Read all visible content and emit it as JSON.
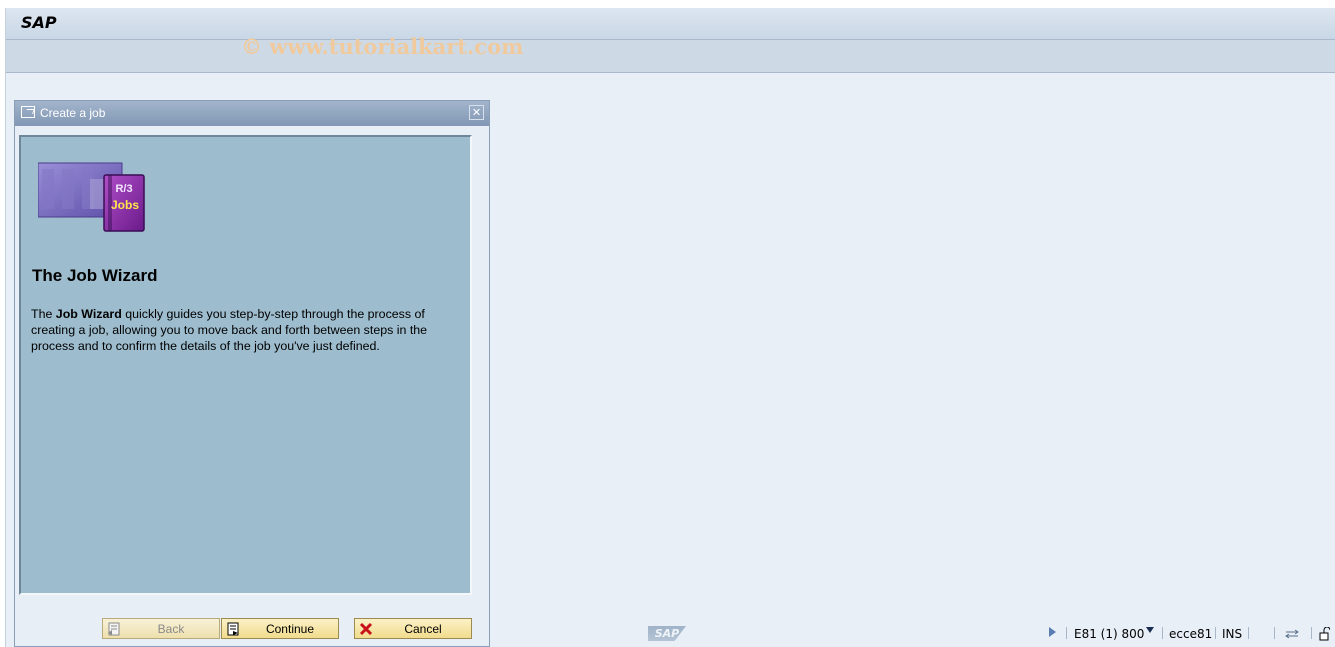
{
  "app": {
    "title": "SAP",
    "watermark": "© www.tutorialkart.com"
  },
  "dialog": {
    "title": "Create a job",
    "close_icon": "close-icon",
    "logo": {
      "line1": "R/3",
      "line2": "Jobs"
    },
    "heading": "The Job Wizard",
    "description": {
      "prefix": "The ",
      "bold": "Job Wizard",
      "suffix": " quickly guides you step-by-step through the process of creating a job, allowing you to move back and forth between steps in the process and to confirm the details of the job you've just defined."
    },
    "buttons": {
      "back": "Back",
      "continue": "Continue",
      "cancel": "Cancel"
    }
  },
  "statusbar": {
    "sap_logo": "SAP",
    "system": "E81 (1) 800",
    "server": "ecce81",
    "mode": "INS"
  },
  "colors": {
    "dialog_header": "#8197b4",
    "content_bg": "#9dbccd",
    "button_bg": "#f1dc8d",
    "watermark": "#f0c99c"
  }
}
